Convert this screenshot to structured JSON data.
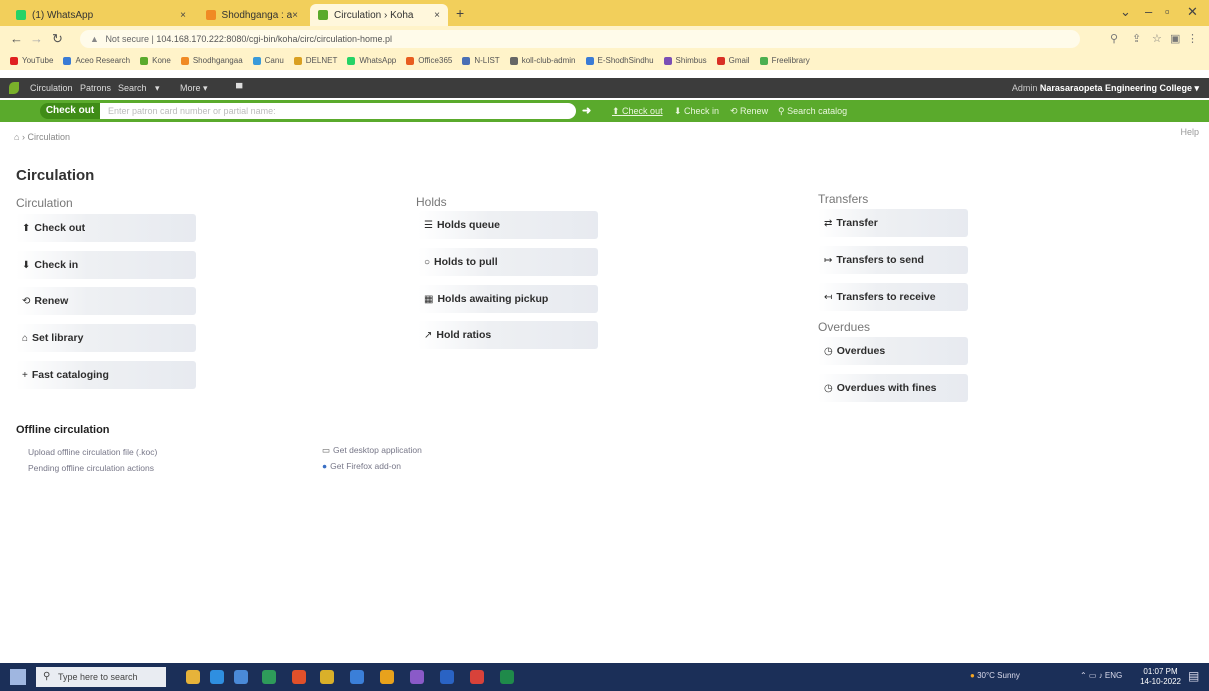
{
  "browser": {
    "tabs": [
      {
        "label": "(1) WhatsApp",
        "color": "#25d366"
      },
      {
        "label": "Shodhganga : a reservoir of Ind",
        "color": "#f08a24"
      },
      {
        "label": "Circulation › Koha",
        "color": "#5aaa2c"
      }
    ],
    "tab_close": "×",
    "new_tab": "+",
    "url_security": "Not secure",
    "url": "104.168.170.222:8080/cgi-bin/koha/circ/circulation-home.pl",
    "bookmarks": [
      {
        "label": "YouTube",
        "color": "#e02020"
      },
      {
        "label": "Aceo Research",
        "color": "#3a7bd5"
      },
      {
        "label": "Kone",
        "color": "#5aaa2c"
      },
      {
        "label": "Shodhgangaa",
        "color": "#f08a24"
      },
      {
        "label": "Canu",
        "color": "#3a9ad9"
      },
      {
        "label": "DELNET",
        "color": "#d9a021"
      },
      {
        "label": "WhatsApp",
        "color": "#25d366"
      },
      {
        "label": "Office365",
        "color": "#e85d20"
      },
      {
        "label": "N-LIST",
        "color": "#4a6fb5"
      },
      {
        "label": "koll-club-admin",
        "color": "#666666"
      },
      {
        "label": "E-ShodhSindhu",
        "color": "#3a7bd5"
      },
      {
        "label": "Shimbus",
        "color": "#7a4fb5"
      },
      {
        "label": "Gmail",
        "color": "#d93025"
      },
      {
        "label": "Freelibrary",
        "color": "#4caf50"
      }
    ]
  },
  "koha_nav": {
    "items": [
      "Circulation",
      "Patrons",
      "Search",
      "More ▾"
    ],
    "user_prefix": "Admin",
    "library": "Narasaraopeta Engineering College ▾"
  },
  "header_search": {
    "button": "Check out",
    "placeholder": "Enter patron card number or partial name:",
    "go": "➜",
    "tabs": [
      "Check out",
      "Check in",
      "Renew",
      "Search catalog"
    ]
  },
  "breadcrumb": {
    "home_icon": "home-icon",
    "sep": "›",
    "current": "Circulation"
  },
  "help": "Help",
  "page_title": "Circulation",
  "circulation": {
    "heading": "Circulation",
    "links": [
      {
        "icon": "⬆",
        "label": "Check out"
      },
      {
        "icon": "⬇",
        "label": "Check in"
      },
      {
        "icon": "⟲",
        "label": "Renew"
      },
      {
        "icon": "⌂",
        "label": "Set library"
      },
      {
        "icon": "+",
        "label": "Fast cataloging"
      }
    ]
  },
  "holds": {
    "heading": "Holds",
    "links": [
      {
        "icon": "☰",
        "label": "Holds queue"
      },
      {
        "icon": "○",
        "label": "Holds to pull"
      },
      {
        "icon": "▦",
        "label": "Holds awaiting pickup"
      },
      {
        "icon": "↗",
        "label": "Hold ratios"
      }
    ]
  },
  "transfers": {
    "heading": "Transfers",
    "links": [
      {
        "icon": "⇄",
        "label": "Transfer"
      },
      {
        "icon": "↦",
        "label": "Transfers to send"
      },
      {
        "icon": "↤",
        "label": "Transfers to receive"
      }
    ]
  },
  "overdues": {
    "heading": "Overdues",
    "links": [
      {
        "icon": "◷",
        "label": "Overdues"
      },
      {
        "icon": "◷",
        "label": "Overdues with fines"
      }
    ]
  },
  "offline": {
    "heading": "Offline circulation",
    "upload": "Upload offline circulation file (.koc)",
    "pending": "Pending offline circulation actions",
    "desktop_icon": "▭",
    "desktop": "Get desktop application",
    "firefox_icon": "●",
    "firefox": "Get Firefox add-on"
  },
  "taskbar": {
    "search_placeholder": "Type here to search",
    "weather": "30°C Sunny",
    "time": "01:07 PM",
    "date": "14-10-2022"
  }
}
